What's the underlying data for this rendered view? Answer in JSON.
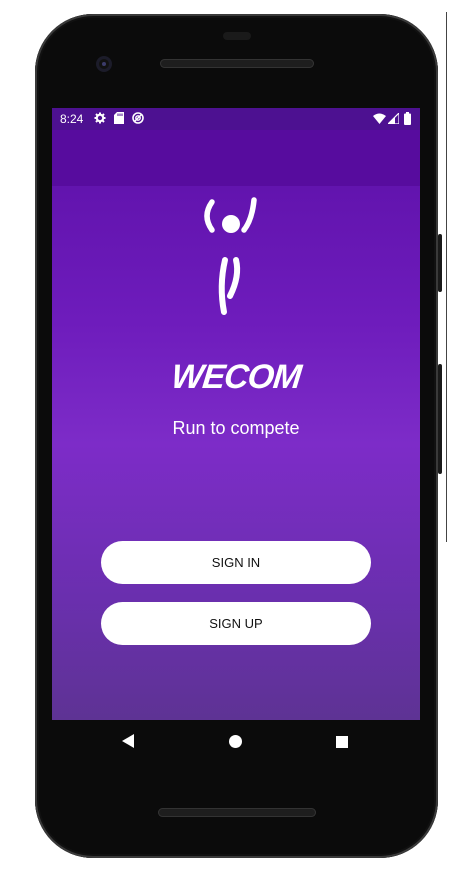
{
  "status_bar": {
    "time": "8:24",
    "left_icons": [
      "gear-icon",
      "sd-card-icon",
      "sync-icon"
    ],
    "right_icons": [
      "wifi-icon",
      "signal-icon",
      "battery-icon"
    ]
  },
  "app": {
    "logo_icon": "runner-figure-icon",
    "brand": "WECOM",
    "tagline": "Run to compete",
    "sign_in_label": "SIGN IN",
    "sign_up_label": "SIGN UP"
  },
  "nav_bar": {
    "buttons": [
      "back-icon",
      "home-icon",
      "recent-apps-icon"
    ]
  },
  "colors": {
    "accent_top": "#5b0fa6",
    "accent_mid": "#7d2cc8",
    "accent_bottom": "#5e3394",
    "button_bg": "#ffffff"
  }
}
